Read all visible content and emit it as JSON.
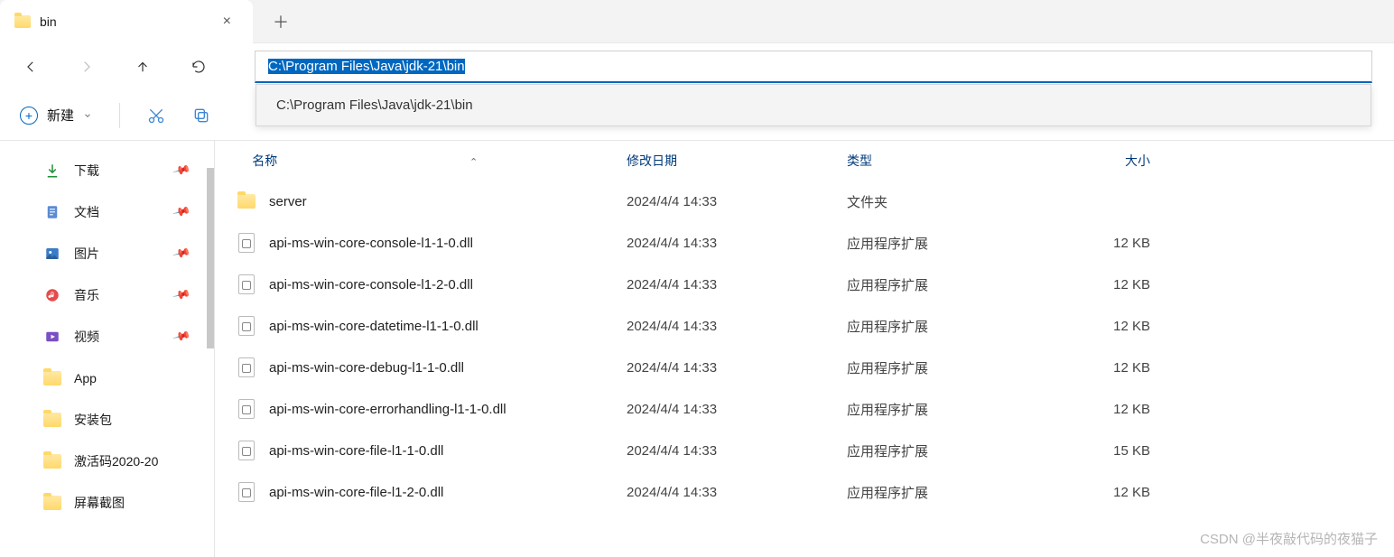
{
  "tab": {
    "title": "bin"
  },
  "address": {
    "value": "C:\\Program Files\\Java\\jdk-21\\bin",
    "suggestion": "C:\\Program Files\\Java\\jdk-21\\bin"
  },
  "toolbar": {
    "new_label": "新建"
  },
  "sidebar": {
    "items": [
      {
        "label": "下载",
        "pinned": true,
        "icon": "download"
      },
      {
        "label": "文档",
        "pinned": true,
        "icon": "document"
      },
      {
        "label": "图片",
        "pinned": true,
        "icon": "picture"
      },
      {
        "label": "音乐",
        "pinned": true,
        "icon": "music"
      },
      {
        "label": "视频",
        "pinned": true,
        "icon": "video"
      },
      {
        "label": "App",
        "pinned": false,
        "icon": "folder"
      },
      {
        "label": "安装包",
        "pinned": false,
        "icon": "folder"
      },
      {
        "label": "激活码2020-20",
        "pinned": false,
        "icon": "folder"
      },
      {
        "label": "屏幕截图",
        "pinned": false,
        "icon": "folder"
      }
    ]
  },
  "columns": {
    "name": "名称",
    "date": "修改日期",
    "type": "类型",
    "size": "大小"
  },
  "files": [
    {
      "name": "server",
      "date": "2024/4/4 14:33",
      "type": "文件夹",
      "size": "",
      "kind": "folder"
    },
    {
      "name": "api-ms-win-core-console-l1-1-0.dll",
      "date": "2024/4/4 14:33",
      "type": "应用程序扩展",
      "size": "12 KB",
      "kind": "dll"
    },
    {
      "name": "api-ms-win-core-console-l1-2-0.dll",
      "date": "2024/4/4 14:33",
      "type": "应用程序扩展",
      "size": "12 KB",
      "kind": "dll"
    },
    {
      "name": "api-ms-win-core-datetime-l1-1-0.dll",
      "date": "2024/4/4 14:33",
      "type": "应用程序扩展",
      "size": "12 KB",
      "kind": "dll"
    },
    {
      "name": "api-ms-win-core-debug-l1-1-0.dll",
      "date": "2024/4/4 14:33",
      "type": "应用程序扩展",
      "size": "12 KB",
      "kind": "dll"
    },
    {
      "name": "api-ms-win-core-errorhandling-l1-1-0.dll",
      "date": "2024/4/4 14:33",
      "type": "应用程序扩展",
      "size": "12 KB",
      "kind": "dll"
    },
    {
      "name": "api-ms-win-core-file-l1-1-0.dll",
      "date": "2024/4/4 14:33",
      "type": "应用程序扩展",
      "size": "15 KB",
      "kind": "dll"
    },
    {
      "name": "api-ms-win-core-file-l1-2-0.dll",
      "date": "2024/4/4 14:33",
      "type": "应用程序扩展",
      "size": "12 KB",
      "kind": "dll"
    }
  ],
  "watermark": "CSDN @半夜敲代码的夜猫子"
}
